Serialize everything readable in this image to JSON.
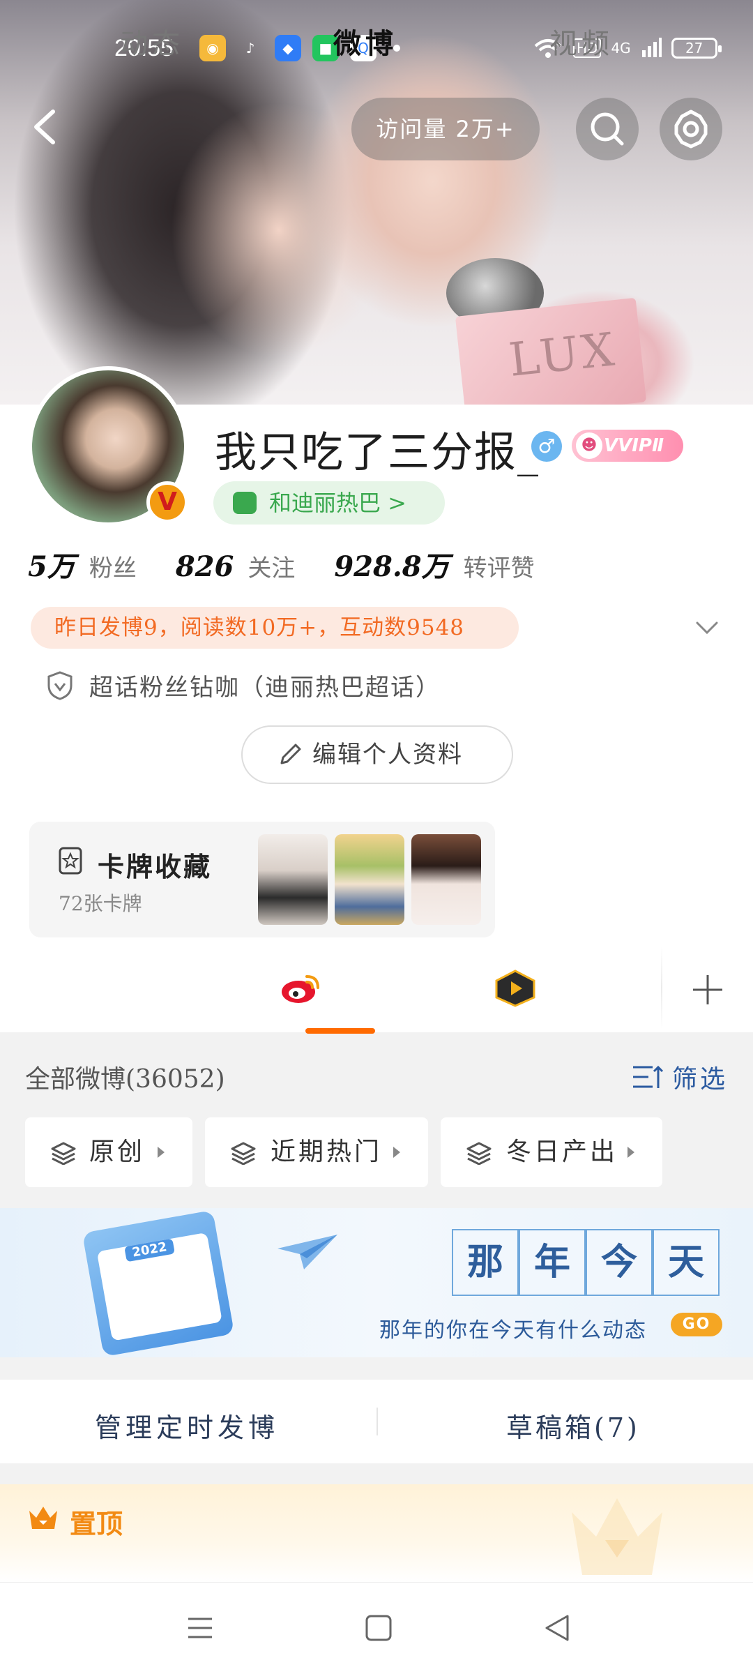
{
  "status_bar": {
    "time": "20:55",
    "network": "HD",
    "signal": "4G",
    "battery": "27"
  },
  "top_bar": {
    "visits_label": "访问量 2万+"
  },
  "profile": {
    "name": "我只吃了三分报_",
    "gender_symbol": "♂",
    "vip_label": "VVIPⅡ",
    "group_label": "和迪丽热巴 >",
    "verified_badge": "V",
    "stats": [
      {
        "value": "5万",
        "label": "粉丝"
      },
      {
        "value": "826",
        "label": "关注"
      },
      {
        "value": "928.8万",
        "label": "转评赞"
      }
    ],
    "summary": "昨日发博9，阅读数10万+，互动数9548",
    "superfan": "超话粉丝钻咖（迪丽热巴超话）",
    "edit_button": "编辑个人资料"
  },
  "cards": {
    "title": "卡牌收藏",
    "count": "72张卡牌"
  },
  "tabs": [
    {
      "label": "动态"
    },
    {
      "label": "微博"
    },
    {
      "label": "视频"
    }
  ],
  "feed": {
    "all_label": "全部微博(36052)",
    "filter_label": "筛选",
    "chips": [
      {
        "label": "原创"
      },
      {
        "label": "近期热门"
      },
      {
        "label": "冬日产出"
      }
    ]
  },
  "banner": {
    "title_chars": [
      "那",
      "年",
      "今",
      "天"
    ],
    "subtitle": "那年的你在今天有什么动态",
    "go": "GO",
    "calendar_year": "2022"
  },
  "manage": {
    "scheduled": "管理定时发博",
    "drafts": "草稿箱(7)"
  },
  "pinned": {
    "label": "置顶"
  },
  "colors": {
    "accent_orange": "#ff6a00",
    "group_green": "#3aa84e",
    "summary_orange": "#f26a23",
    "link_blue": "#2b5aa0"
  },
  "icons": [
    "back-icon",
    "search-icon",
    "gear-icon",
    "chevron-down-icon",
    "shield-icon",
    "pencil-icon",
    "card-icon",
    "weibo-logo-icon",
    "video-icon",
    "plus-icon",
    "filter-icon",
    "layers-icon",
    "crown-icon",
    "menu-icon",
    "home-square-icon",
    "back-triangle-icon"
  ]
}
